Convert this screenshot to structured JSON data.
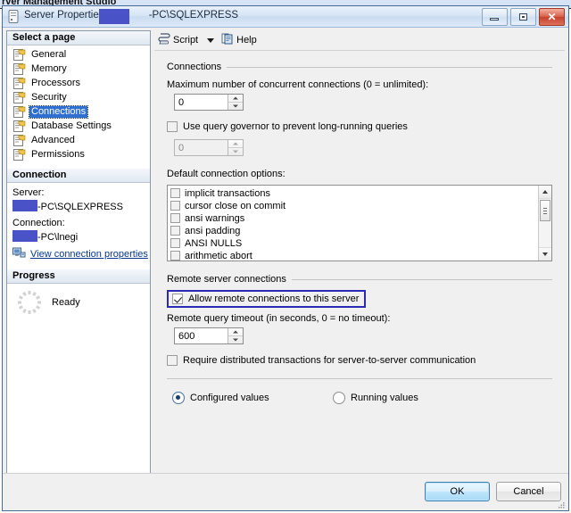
{
  "background_window": {
    "title_fragment": "rver Management Studio"
  },
  "window": {
    "title_prefix": "Server Properties -",
    "title_suffix": "-PC\\SQLEXPRESS",
    "icon": "server-icon",
    "controls": {
      "minimize": "minimize-icon",
      "maximize": "maximize-icon",
      "close": "✕"
    }
  },
  "sidebar": {
    "select_page_header": "Select a page",
    "pages": [
      {
        "label": "General",
        "selected": false
      },
      {
        "label": "Memory",
        "selected": false
      },
      {
        "label": "Processors",
        "selected": false
      },
      {
        "label": "Security",
        "selected": false
      },
      {
        "label": "Connections",
        "selected": true
      },
      {
        "label": "Database Settings",
        "selected": false
      },
      {
        "label": "Advanced",
        "selected": false
      },
      {
        "label": "Permissions",
        "selected": false
      }
    ],
    "connection": {
      "header": "Connection",
      "server_label": "Server:",
      "server_value": "-PC\\SQLEXPRESS",
      "connection_label": "Connection:",
      "connection_value": "-PC\\lnegi",
      "view_properties_link": "View connection properties"
    },
    "progress": {
      "header": "Progress",
      "status": "Ready"
    }
  },
  "toolbar": {
    "script_label": "Script",
    "help_label": "Help"
  },
  "main": {
    "connections_group": {
      "title": "Connections",
      "max_connections_label": "Maximum number of concurrent connections (0 = unlimited):",
      "max_connections_value": "0",
      "query_governor_label": "Use query governor to prevent long-running queries",
      "query_governor_checked": false,
      "query_governor_value": "0",
      "default_options_label": "Default connection options:",
      "default_options": [
        {
          "label": "implicit transactions",
          "checked": false
        },
        {
          "label": "cursor close on commit",
          "checked": false
        },
        {
          "label": "ansi warnings",
          "checked": false
        },
        {
          "label": "ansi padding",
          "checked": false
        },
        {
          "label": "ANSI NULLS",
          "checked": false
        },
        {
          "label": "arithmetic abort",
          "checked": false
        }
      ]
    },
    "remote_group": {
      "title": "Remote server connections",
      "allow_remote_label": "Allow remote connections to this server",
      "allow_remote_checked": true,
      "allow_remote_focused": true,
      "remote_timeout_label": "Remote query timeout (in seconds, 0 = no timeout):",
      "remote_timeout_value": "600",
      "distributed_label": "Require distributed transactions for server-to-server communication",
      "distributed_checked": false
    },
    "values_mode": {
      "configured_label": "Configured values",
      "running_label": "Running values",
      "selected": "configured"
    }
  },
  "footer": {
    "ok_label": "OK",
    "cancel_label": "Cancel"
  },
  "colors": {
    "accent_blue": "#2f6fd0",
    "focus_highlight": "#2a2ab4",
    "redaction": "#4a52c8",
    "link": "#06368f",
    "close_red": "#c4422d"
  }
}
